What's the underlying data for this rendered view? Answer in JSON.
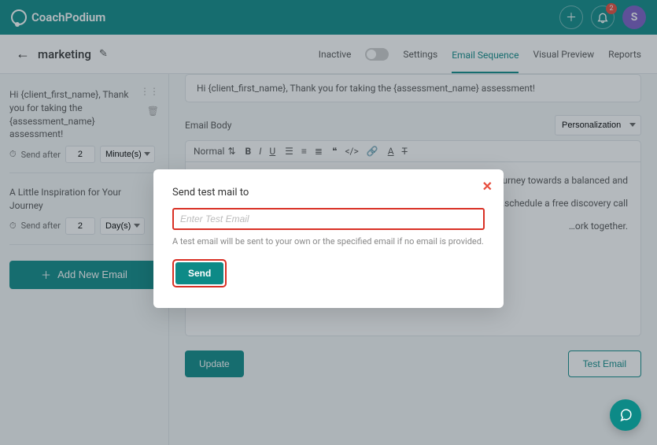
{
  "brand": "CoachPodium",
  "topbar": {
    "notif_count": "2",
    "avatar_initial": "S"
  },
  "page": {
    "back_title": "marketing",
    "status_label": "Inactive",
    "tabs": {
      "settings": "Settings",
      "email_seq": "Email Sequence",
      "visual": "Visual Preview",
      "reports": "Reports"
    }
  },
  "sidebar": {
    "emails": [
      {
        "subject": "Hi {client_first_name}, Thank you for taking the {assessment_name} assessment!",
        "send_label": "Send after",
        "value": "2",
        "unit": "Minute(s)"
      },
      {
        "subject": "A Little Inspiration for Your Journey",
        "send_label": "Send after",
        "value": "2",
        "unit": "Day(s)"
      }
    ],
    "add_label": "Add New Email"
  },
  "editor": {
    "subject_preview": "Hi {client_first_name}, Thank you for taking the {assessment_name} assessment!",
    "body_label": "Email Body",
    "personalization": "Personalization",
    "block_format": "Normal",
    "body_p1": "…urney towards a balanced and",
    "body_p2": "…schedule a free discovery call",
    "body_p3": "…ork together.",
    "update_btn": "Update",
    "test_btn": "Test Email"
  },
  "modal": {
    "title": "Send test mail to",
    "placeholder": "Enter Test Email",
    "hint": "A test email will be sent to your own or the specified email if no email is provided.",
    "send": "Send"
  }
}
